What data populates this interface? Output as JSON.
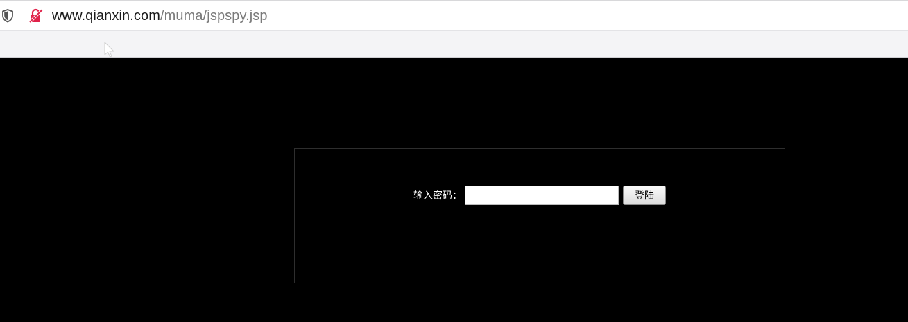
{
  "addressbar": {
    "url_host": "www.qianxin.com",
    "url_path": "/muma/jspspy.jsp"
  },
  "icons": {
    "shield": "shield-icon",
    "insecure": "insecure-connection-icon",
    "cursor": "mouse-cursor-icon"
  },
  "login": {
    "label": "输入密码：",
    "password_value": "",
    "button_label": "登陆"
  },
  "colors": {
    "page_background": "#000000",
    "insecure_icon": "#e0224a",
    "toolbar_background": "#f4f4f6"
  }
}
